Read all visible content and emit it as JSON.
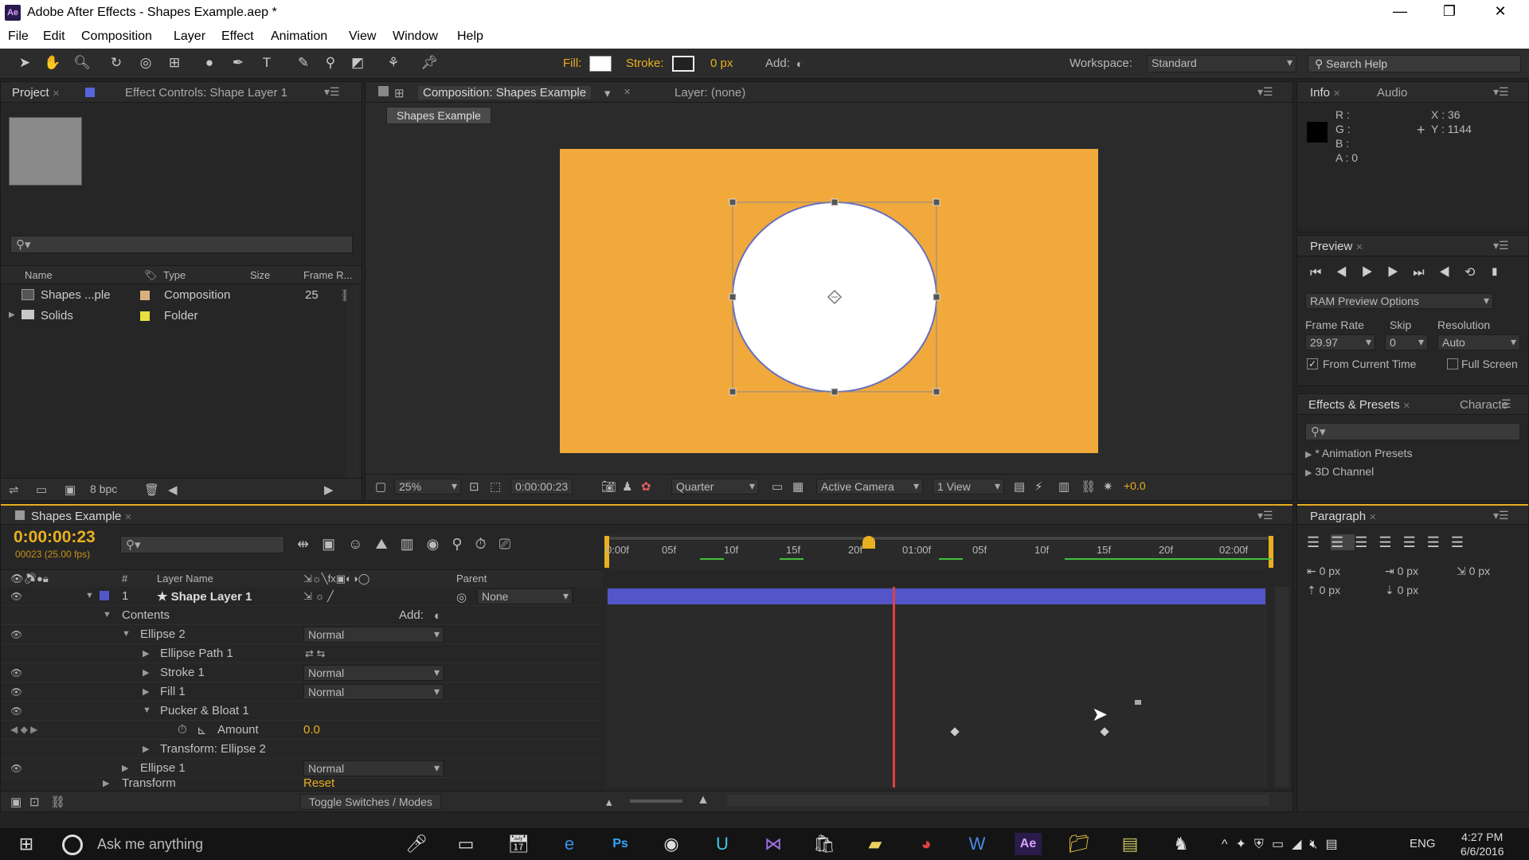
{
  "window": {
    "title": "Adobe After Effects - Shapes Example.aep *",
    "app_icon": "Ae"
  },
  "menu": [
    "File",
    "Edit",
    "Composition",
    "Layer",
    "Effect",
    "Animation",
    "View",
    "Window",
    "Help"
  ],
  "toolbar": {
    "fill_label": "Fill:",
    "stroke_label": "Stroke:",
    "stroke_width": "0 px",
    "add_label": "Add:",
    "workspace_label": "Workspace:",
    "workspace_value": "Standard",
    "search_help": "Search Help"
  },
  "project": {
    "tab": "Project",
    "effect_controls_tab": "Effect Controls: Shape Layer 1",
    "columns": [
      "Name",
      "Type",
      "Size",
      "Frame R..."
    ],
    "items": [
      {
        "name": "Shapes ...ple",
        "type": "Composition",
        "frame_rate": "25",
        "color": "#d8b080"
      },
      {
        "name": "Solids",
        "type": "Folder",
        "frame_rate": "",
        "color": "#e8e040"
      }
    ],
    "bpc": "8 bpc"
  },
  "composition": {
    "tab": "Composition: Shapes Example",
    "layer_tab": "Layer: (none)",
    "breadcrumb": "Shapes Example",
    "bg_color": "#f2a93b",
    "zoom": "25%",
    "timecode": "0:00:00:23",
    "resolution": "Quarter",
    "camera": "Active Camera",
    "views": "1 View",
    "exposure": "+0.0"
  },
  "info": {
    "tab": "Info",
    "audio_tab": "Audio",
    "r": "R :",
    "g": "G :",
    "b": "B :",
    "a": "A : 0",
    "x": "X : 36",
    "y": "Y : 1144"
  },
  "preview": {
    "tab": "Preview",
    "ram_options": "RAM Preview Options",
    "frame_rate_label": "Frame Rate",
    "skip_label": "Skip",
    "resolution_label": "Resolution",
    "frame_rate": "29.97",
    "skip": "0",
    "resolution": "Auto",
    "from_current": "From Current Time",
    "full_screen": "Full Screen"
  },
  "effects": {
    "tab": "Effects & Presets",
    "char_tab": "Characte",
    "items": [
      "* Animation Presets",
      "3D Channel"
    ]
  },
  "paragraph": {
    "tab": "Paragraph",
    "values": [
      "0 px",
      "0 px",
      "0 px",
      "0 px",
      "0 px"
    ]
  },
  "timeline": {
    "tab": "Shapes Example",
    "timecode": "0:00:00:23",
    "frames_info": "00023 (25.00 fps)",
    "col_layer_name": "Layer Name",
    "col_parent": "Parent",
    "ruler": [
      "0:00f",
      "05f",
      "10f",
      "15f",
      "20f",
      "01:00f",
      "05f",
      "10f",
      "15f",
      "20f",
      "02:00f"
    ],
    "rows": [
      {
        "num": "1",
        "name": "Shape Layer 1",
        "parent": "None"
      },
      {
        "name": "Contents",
        "add": "Add:"
      },
      {
        "name": "Ellipse 2",
        "mode": "Normal"
      },
      {
        "name": "Ellipse Path 1"
      },
      {
        "name": "Stroke 1",
        "mode": "Normal"
      },
      {
        "name": "Fill 1",
        "mode": "Normal"
      },
      {
        "name": "Pucker & Bloat 1"
      },
      {
        "name": "Amount",
        "value": "0.0"
      },
      {
        "name": "Transform: Ellipse 2"
      },
      {
        "name": "Ellipse 1",
        "mode": "Normal"
      },
      {
        "name": "Transform",
        "value": "Reset"
      }
    ],
    "toggle": "Toggle Switches / Modes"
  },
  "taskbar": {
    "search": "Ask me anything",
    "lang": "ENG",
    "time": "4:27 PM",
    "date": "6/6/2016"
  },
  "colors": {
    "accent": "#e8b020",
    "layer_bar": "#5356c8",
    "timecode": "#e8b020"
  }
}
